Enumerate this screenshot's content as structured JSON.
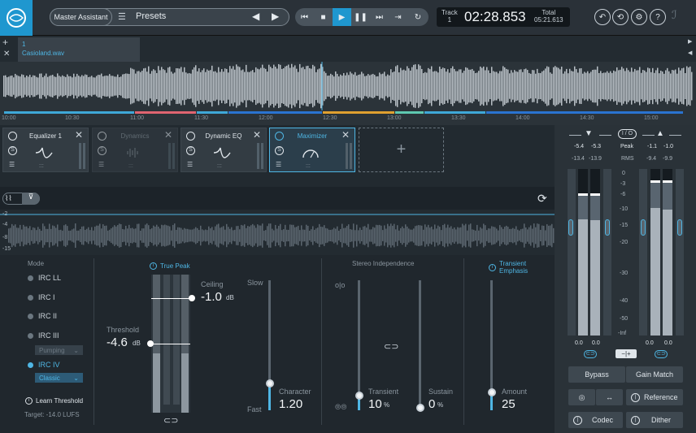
{
  "toolbar": {
    "master_assistant": "Master Assistant",
    "presets": "Presets",
    "track_label": "Track",
    "track_num": "1",
    "time": "02:28.853",
    "total_label": "Total",
    "total_time": "05:21.613"
  },
  "file_tab": {
    "number": "1",
    "name": "Casioland.wav"
  },
  "timeline_ticks": [
    "10:00",
    "10:30",
    "11:00",
    "11:30",
    "12:00",
    "12:30",
    "13:00",
    "13:30",
    "14:00",
    "14:30",
    "15:00"
  ],
  "modules": [
    {
      "name": "Equalizer 1",
      "enabled": true
    },
    {
      "name": "Dynamics",
      "enabled": false
    },
    {
      "name": "Dynamic EQ",
      "enabled": true
    },
    {
      "name": "Maximizer",
      "enabled": true,
      "selected": true
    }
  ],
  "scope_db": [
    "-2",
    "-4",
    "-8",
    "-15"
  ],
  "maximizer": {
    "mode_label": "Mode",
    "modes": [
      "IRC LL",
      "IRC I",
      "IRC II",
      "IRC III",
      "IRC IV"
    ],
    "mode_selected": "IRC IV",
    "irc3_sub": "Pumping",
    "irc4_sub": "Classic",
    "learn_threshold": "Learn Threshold",
    "target": "Target: -14.0 LUFS",
    "true_peak": "True Peak",
    "threshold_label": "Threshold",
    "threshold_value": "-4.6",
    "threshold_unit": "dB",
    "ceiling_label": "Ceiling",
    "ceiling_value": "-1.0",
    "ceiling_unit": "dB",
    "slow_label": "Slow",
    "fast_label": "Fast",
    "character_label": "Character",
    "character_value": "1.20",
    "stereo_label": "Stereo Independence",
    "transient_label": "Transient",
    "transient_value": "10",
    "sustain_label": "Sustain",
    "sustain_value": "0",
    "percent": "%",
    "te_label_1": "Transient",
    "te_label_2": "Emphasis",
    "amount_label": "Amount",
    "amount_value": "25"
  },
  "meters": {
    "in_peak_l": "-5.4",
    "in_peak_r": "-5.3",
    "in_rms_l": "-13.4",
    "in_rms_r": "-13.9",
    "out_peak_l": "-1.1",
    "out_peak_r": "-1.0",
    "out_rms_l": "-9.4",
    "out_rms_r": "-9.9",
    "io": "I / O",
    "peak": "Peak",
    "rms": "RMS",
    "scale": [
      "0",
      "-3",
      "-6",
      "-10",
      "-15",
      "-20",
      "-30",
      "-40",
      "-50",
      "-Inf"
    ],
    "in_val_l": "0.0",
    "in_val_r": "0.0",
    "out_val_l": "0.0",
    "out_val_r": "0.0",
    "bypass": "Bypass",
    "gain_match": "Gain Match",
    "reference": "Reference",
    "codec": "Codec",
    "dither": "Dither"
  }
}
